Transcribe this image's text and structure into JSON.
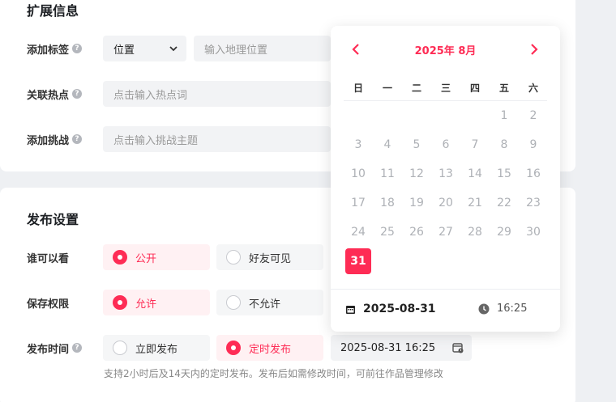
{
  "extend": {
    "title": "扩展信息",
    "tag_label": "添加标签",
    "tag_select": "位置",
    "location_placeholder": "输入地理位置",
    "hotspot_label": "关联热点",
    "hotspot_placeholder": "点击输入热点词",
    "challenge_label": "添加挑战",
    "challenge_placeholder": "点击输入挑战主题"
  },
  "publish": {
    "title": "发布设置",
    "visibility_label": "谁可以看",
    "visibility_options": [
      "公开",
      "好友可见"
    ],
    "save_label": "保存权限",
    "save_options": [
      "允许",
      "不允许"
    ],
    "time_label": "发布时间",
    "time_options": [
      "立即发布",
      "定时发布"
    ],
    "datetime_value": "2025-08-31 16:25",
    "hint": "支持2小时后及14天内的定时发布。发布后如需修改时间，可前往作品管理修改"
  },
  "calendar": {
    "month_title": "2025年 8月",
    "weekdays": [
      "日",
      "一",
      "二",
      "三",
      "四",
      "五",
      "六"
    ],
    "days": [
      "1",
      "2",
      "3",
      "4",
      "5",
      "6",
      "7",
      "8",
      "9",
      "10",
      "11",
      "12",
      "13",
      "14",
      "15",
      "16",
      "17",
      "18",
      "19",
      "20",
      "21",
      "22",
      "23",
      "24",
      "25",
      "26",
      "27",
      "28",
      "29",
      "30",
      "31"
    ],
    "selected_day": "31",
    "footer_date": "2025-08-31",
    "footer_time": "16:25"
  },
  "colors": {
    "accent": "#fe2c55"
  },
  "icons": [
    "help-icon",
    "chevron-down-icon",
    "chevron-left-icon",
    "chevron-right-icon",
    "calendar-icon",
    "clock-icon",
    "calendar-clock-icon"
  ]
}
